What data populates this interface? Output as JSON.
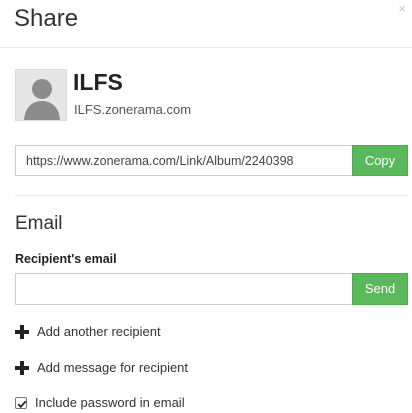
{
  "dialog": {
    "title": "Share",
    "close_glyph": "×"
  },
  "profile": {
    "name": "ILFS",
    "url": "ILFS.zonerama.com",
    "avatar_icon": "user-silhouette-icon"
  },
  "link": {
    "value": "https://www.zonerama.com/Link/Album/2240398",
    "copy_label": "Copy"
  },
  "email": {
    "section_title": "Email",
    "recipient_label": "Recipient's email",
    "recipient_value": "",
    "send_label": "Send",
    "add_recipient_label": "Add another recipient",
    "add_message_label": "Add message for recipient",
    "include_password_label": "Include password in email",
    "include_password_checked": true
  },
  "colors": {
    "accent_green": "#5cb85c",
    "text": "#333333",
    "border": "#cccccc"
  }
}
